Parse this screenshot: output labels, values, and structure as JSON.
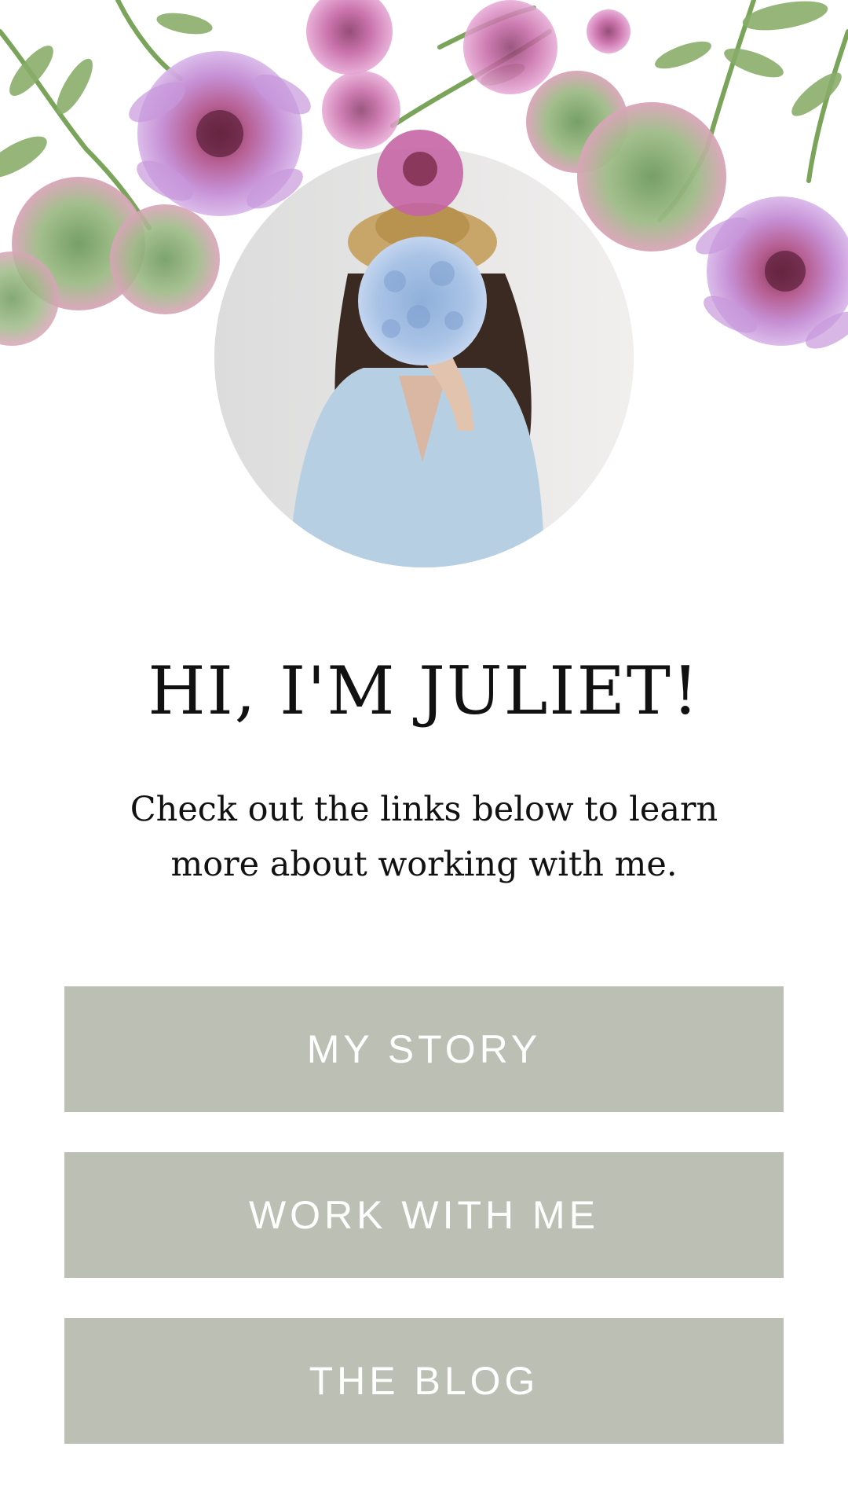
{
  "profile": {
    "headline": "HI, I'M JULIET!",
    "intro_line1": "Check out the links below to learn",
    "intro_line2": "more about working with me.",
    "avatar_icon": "woman-holding-hydrangea-photo"
  },
  "links": [
    {
      "label": "MY STORY"
    },
    {
      "label": "WORK WITH ME"
    },
    {
      "label": "THE BLOG"
    }
  ],
  "colors": {
    "button_bg": "#bcbfb4",
    "button_text": "#ffffff",
    "text": "#111111",
    "background": "#ffffff"
  },
  "decor": {
    "header_icon": "watercolor-floral-border"
  }
}
